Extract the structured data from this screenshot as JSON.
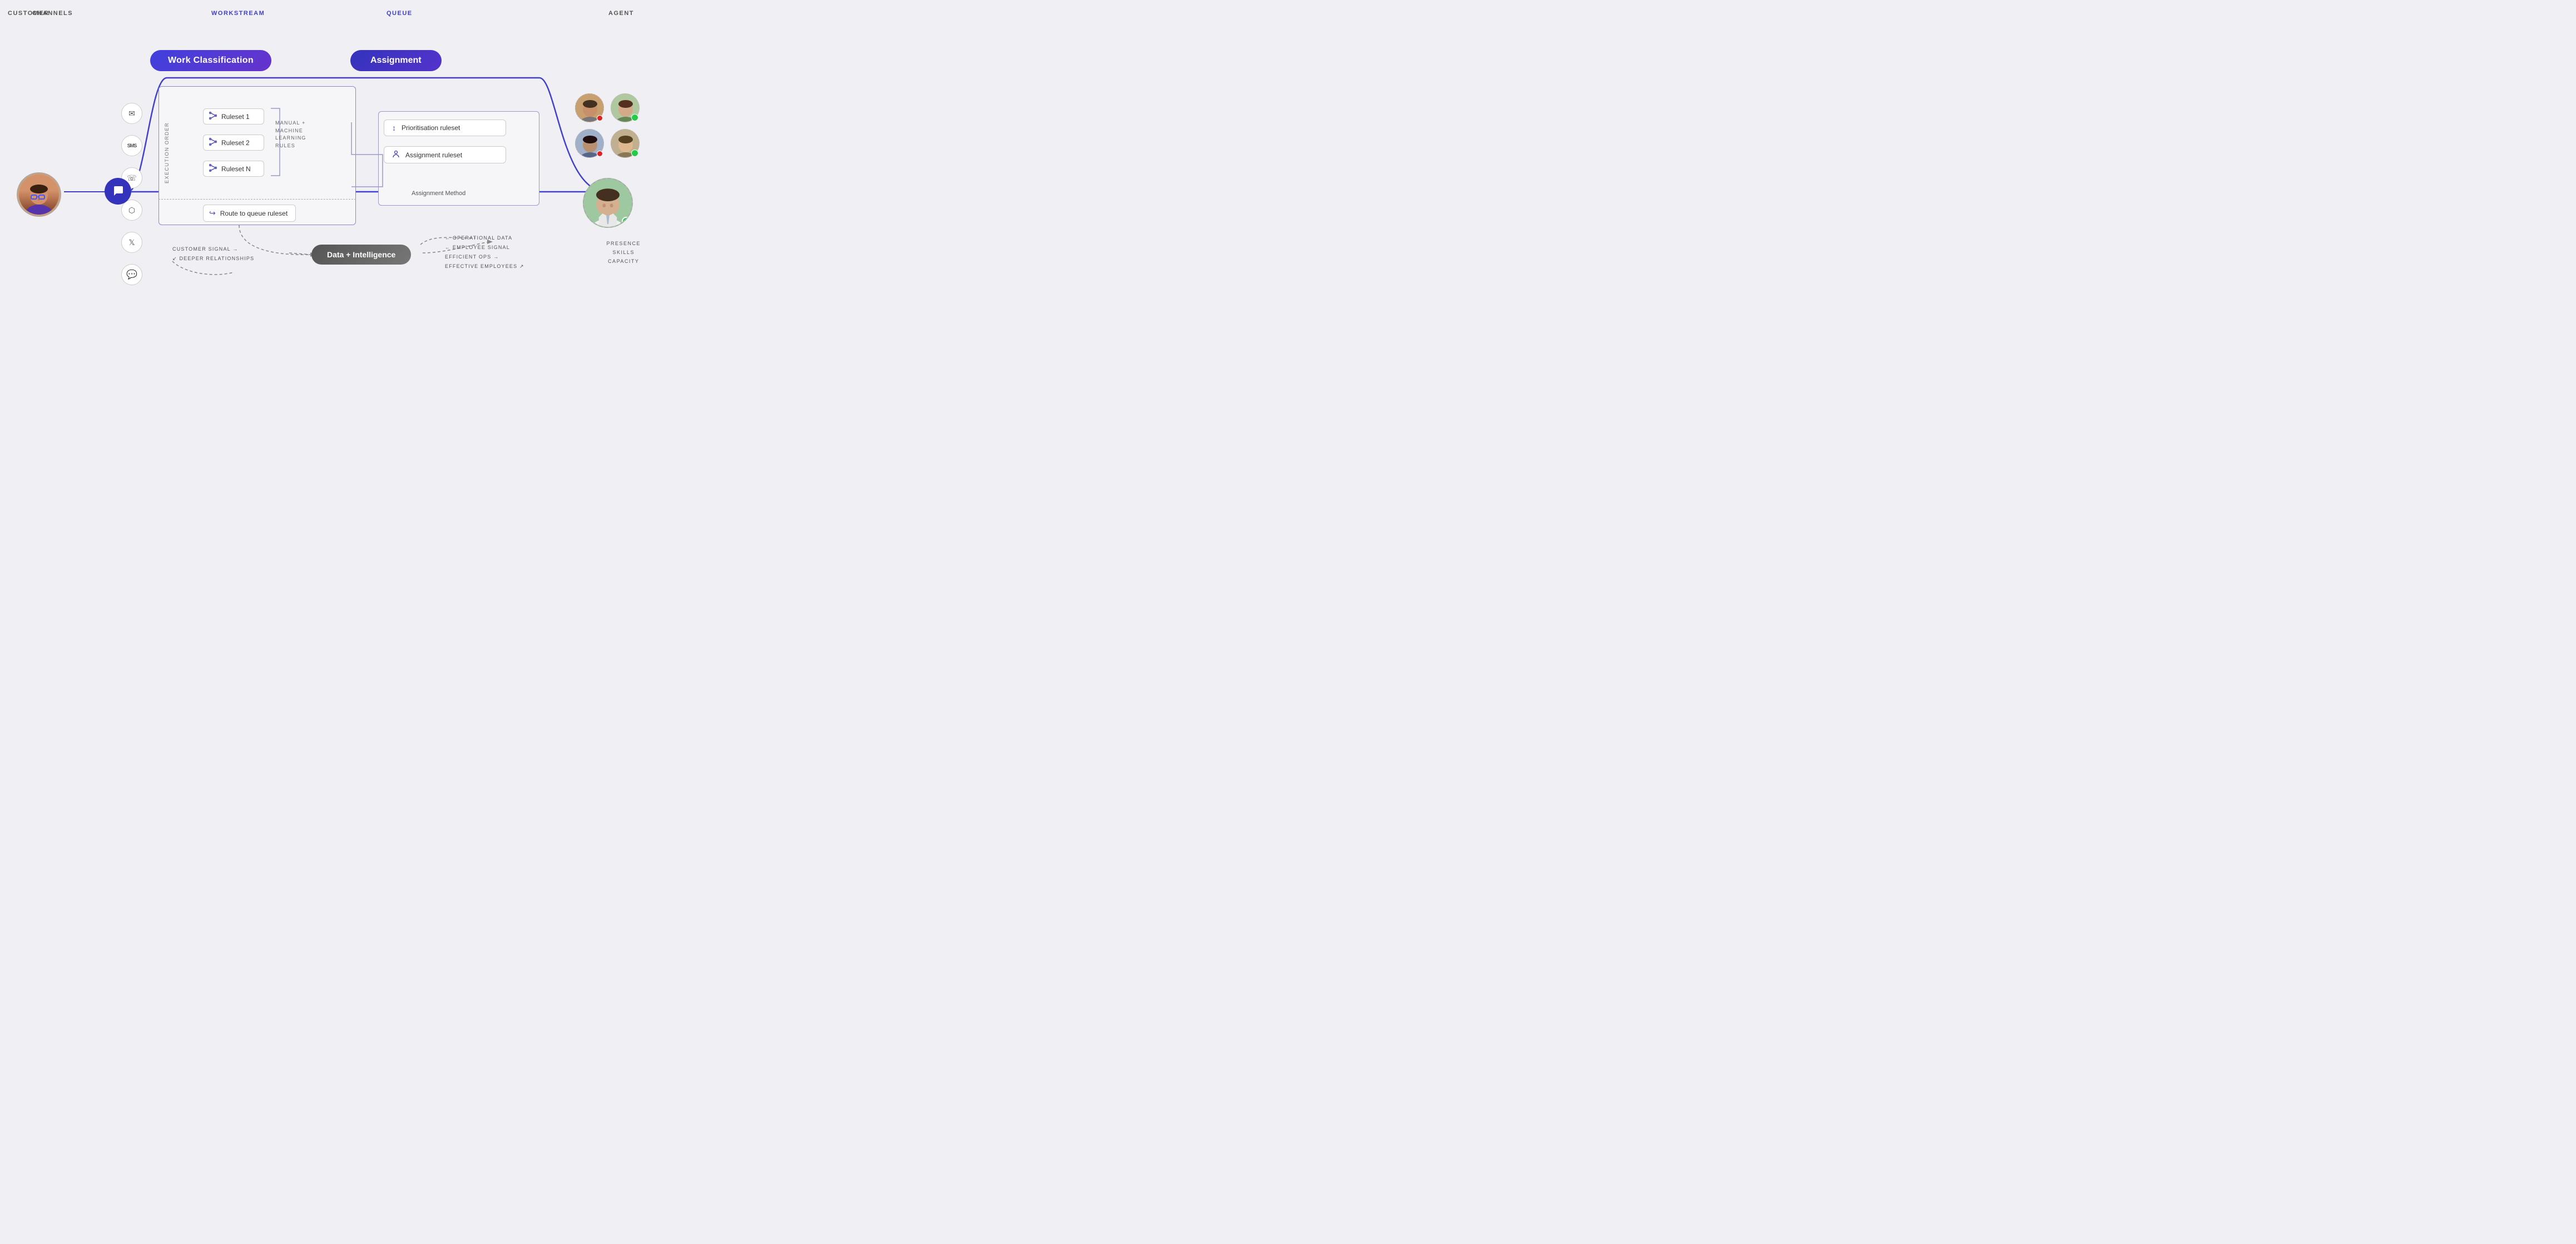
{
  "labels": {
    "customer": "CUSTOMER",
    "channels": "CHANNELS",
    "workstream": "WORKSTREAM",
    "queue": "QUEUE",
    "agent": "AGENT"
  },
  "pills": {
    "workClassification": "Work Classification",
    "assignment": "Assignment",
    "dataIntelligence": "Data + Intelligence"
  },
  "rulesets": [
    {
      "label": "Ruleset 1"
    },
    {
      "label": "Ruleset 2"
    },
    {
      "label": "Ruleset N"
    }
  ],
  "mlLabel": "MANUAL +\nMACHINE\nLEARNING\nRULES",
  "executionOrder": "Execution order",
  "routeToQueue": "Route to queue ruleset",
  "queueItems": [
    {
      "label": "Prioritisation ruleset",
      "icon": "sort"
    },
    {
      "label": "Assignment ruleset",
      "icon": "person"
    }
  ],
  "assignmentMethod": "Assignment Method",
  "bottomLabels": {
    "customerSignal": "CUSTOMER SIGNAL →",
    "deeperRelationships": "↙ DEEPER RELATIONSHIPS",
    "operationalData": "← OPERATIONAL DATA",
    "employeeSignal": "← EMPLOYEE SIGNAL",
    "efficientOps": "EFFICIENT OPS →",
    "effectiveEmployees": "EFFECTIVE EMPLOYEES ↗"
  },
  "agentAttributes": "PRESENCE\nSKILLS\nCAPACITY",
  "colors": {
    "purple": "#4040cc",
    "darkPurple": "#3333aa",
    "pillBg": "#5533cc",
    "darkGray": "#555555"
  }
}
